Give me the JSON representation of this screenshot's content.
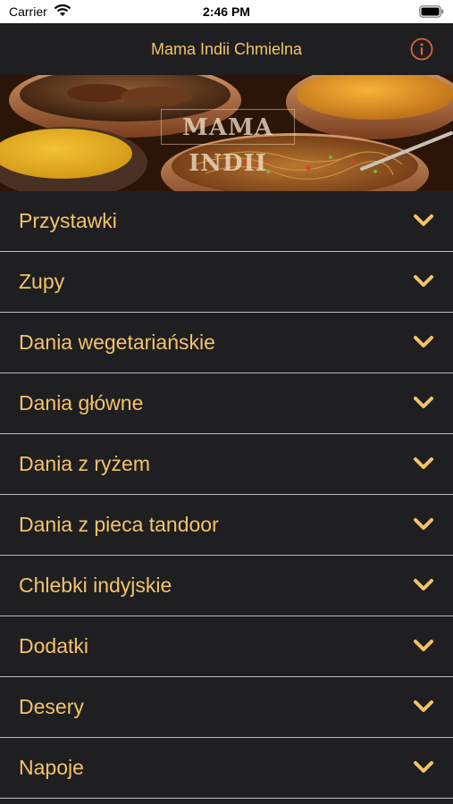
{
  "status_bar": {
    "carrier": "Carrier",
    "time": "2:46 PM"
  },
  "nav": {
    "title": "Mama Indii Chmielna",
    "info_icon": "info-circle-icon"
  },
  "hero": {
    "logo_text": "MAMA INDII"
  },
  "colors": {
    "background": "#1f1f21",
    "accent": "#f4c36a",
    "separator": "#bdbdbd",
    "info_icon": "#e0623a"
  },
  "menu": {
    "items": [
      {
        "label": "Przystawki",
        "icon": "chevron-down-icon"
      },
      {
        "label": "Zupy",
        "icon": "chevron-down-icon"
      },
      {
        "label": "Dania wegetariańskie",
        "icon": "chevron-down-icon"
      },
      {
        "label": "Dania główne",
        "icon": "chevron-down-icon"
      },
      {
        "label": "Dania z ryżem",
        "icon": "chevron-down-icon"
      },
      {
        "label": "Dania z pieca tandoor",
        "icon": "chevron-down-icon"
      },
      {
        "label": "Chlebki indyjskie",
        "icon": "chevron-down-icon"
      },
      {
        "label": "Dodatki",
        "icon": "chevron-down-icon"
      },
      {
        "label": "Desery",
        "icon": "chevron-down-icon"
      },
      {
        "label": "Napoje",
        "icon": "chevron-down-icon"
      }
    ]
  }
}
